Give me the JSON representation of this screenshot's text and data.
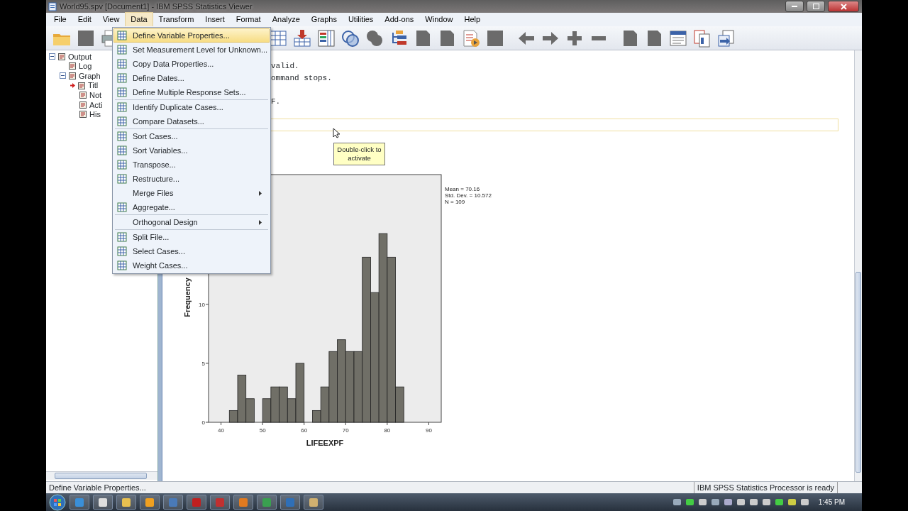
{
  "window": {
    "title": "World95.spv [Document1] - IBM SPSS Statistics Viewer"
  },
  "menu_bar": [
    {
      "label": "File",
      "selected": false
    },
    {
      "label": "Edit",
      "selected": false
    },
    {
      "label": "View",
      "selected": false
    },
    {
      "label": "Data",
      "selected": true
    },
    {
      "label": "Transform",
      "selected": false
    },
    {
      "label": "Insert",
      "selected": false
    },
    {
      "label": "Format",
      "selected": false
    },
    {
      "label": "Analyze",
      "selected": false
    },
    {
      "label": "Graphs",
      "selected": false
    },
    {
      "label": "Utilities",
      "selected": false
    },
    {
      "label": "Add-ons",
      "selected": false
    },
    {
      "label": "Window",
      "selected": false
    },
    {
      "label": "Help",
      "selected": false
    }
  ],
  "data_menu": {
    "items": [
      {
        "kind": "command",
        "label": "Define Variable Properties...",
        "selected": true
      },
      {
        "kind": "command",
        "label": "Set Measurement Level for Unknown...",
        "selected": false
      },
      {
        "kind": "command",
        "label": "Copy Data Properties...",
        "selected": false
      },
      {
        "kind": "command",
        "label": "Define Dates...",
        "selected": false
      },
      {
        "kind": "command",
        "label": "Define Multiple Response Sets...",
        "selected": false
      },
      {
        "kind": "separator"
      },
      {
        "kind": "command",
        "label": "Identify Duplicate Cases...",
        "selected": false
      },
      {
        "kind": "command",
        "label": "Compare Datasets...",
        "selected": false
      },
      {
        "kind": "separator"
      },
      {
        "kind": "command",
        "label": "Sort Cases...",
        "selected": false
      },
      {
        "kind": "command",
        "label": "Sort Variables...",
        "selected": false
      },
      {
        "kind": "command",
        "label": "Transpose...",
        "selected": false
      },
      {
        "kind": "command",
        "label": "Restructure...",
        "selected": false
      },
      {
        "kind": "submenu",
        "label": "Merge Files",
        "selected": false
      },
      {
        "kind": "command",
        "label": "Aggregate...",
        "selected": false
      },
      {
        "kind": "separator"
      },
      {
        "kind": "submenu",
        "label": "Orthogonal Design",
        "selected": false
      },
      {
        "kind": "separator"
      },
      {
        "kind": "command",
        "label": "Split File...",
        "selected": false
      },
      {
        "kind": "command",
        "label": "Select Cases...",
        "selected": false
      },
      {
        "kind": "command",
        "label": "Weight Cases...",
        "selected": false
      }
    ]
  },
  "outline": [
    {
      "label": "Output",
      "expanded": true,
      "current": false,
      "children": [
        {
          "label": "Log",
          "current": false
        },
        {
          "label": "Graph",
          "expanded": true,
          "current": false,
          "children": [
            {
              "label": "Titl",
              "current": true
            },
            {
              "label": "Not",
              "current": false
            },
            {
              "label": "Acti",
              "current": false
            },
            {
              "label": "His",
              "current": false
            }
          ]
        }
      ]
    }
  ],
  "output_text": [
    "valid.",
    "ommand stops.",
    "F."
  ],
  "tooltip": "Double-click to activate",
  "chart": {
    "statistics": [
      "Mean = 70.16",
      "Std. Dev. = 10.572",
      "N = 109"
    ],
    "chart_data": {
      "type": "bar",
      "xlabel": "LIFEEXPF",
      "ylabel": "Frequency",
      "x": [
        43,
        45,
        47,
        49,
        51,
        53,
        55,
        57,
        59,
        61,
        63,
        65,
        67,
        69,
        71,
        73,
        75,
        77,
        79,
        81,
        83
      ],
      "values": [
        1,
        4,
        2,
        0,
        2,
        3,
        3,
        2,
        5,
        0,
        1,
        3,
        6,
        7,
        6,
        6,
        14,
        11,
        16,
        14,
        3
      ],
      "xlim": [
        37,
        93
      ],
      "ylim": [
        0,
        21
      ],
      "xticks": [
        40,
        50,
        60,
        70,
        80,
        90
      ],
      "yticks": [
        0,
        5,
        10
      ]
    }
  },
  "status_bar": {
    "message": "Define Variable Properties...",
    "processor": "IBM SPSS Statistics Processor is ready"
  },
  "taskbar": {
    "clock": "1:45 PM"
  }
}
